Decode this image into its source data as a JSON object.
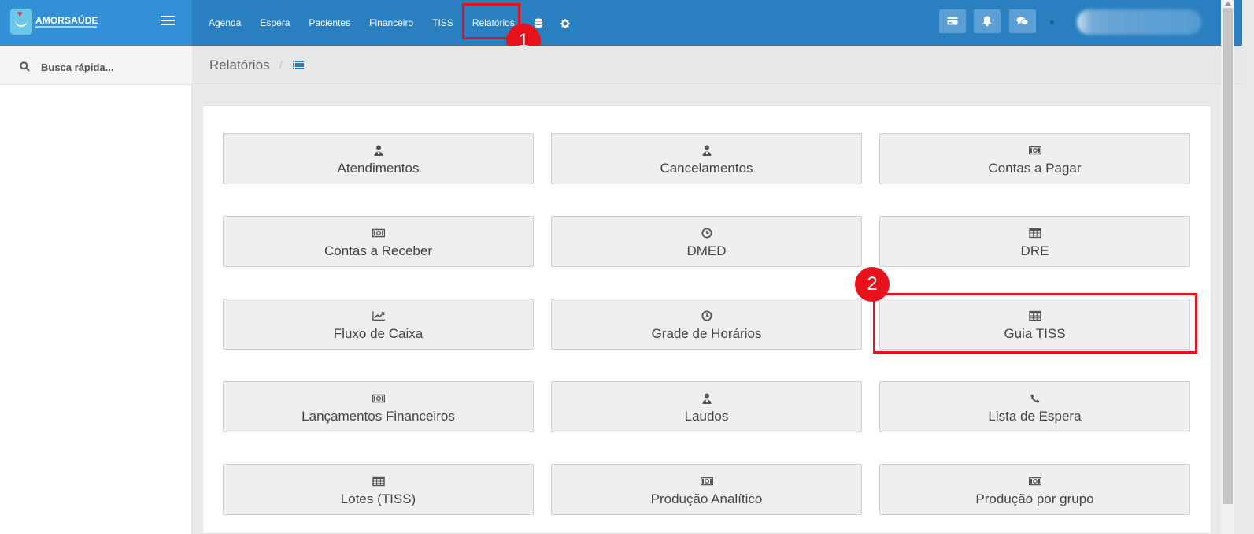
{
  "brand": {
    "logo_text": "AMORSAÚDE"
  },
  "nav": {
    "items": [
      "Agenda",
      "Espera",
      "Pacientes",
      "Financeiro",
      "TISS",
      "Relatórios"
    ]
  },
  "sidebar": {
    "search_placeholder": "Busca rápida..."
  },
  "breadcrumb": {
    "title": "Relatórios",
    "separator": "/"
  },
  "annotations": {
    "step1": "1",
    "step2": "2"
  },
  "reports": [
    {
      "label": "Atendimentos",
      "icon": "user-doctor-icon"
    },
    {
      "label": "Cancelamentos",
      "icon": "user-doctor-icon"
    },
    {
      "label": "Contas a Pagar",
      "icon": "money-bill-icon"
    },
    {
      "label": "Contas a Receber",
      "icon": "money-bill-icon"
    },
    {
      "label": "DMED",
      "icon": "clock-icon"
    },
    {
      "label": "DRE",
      "icon": "table-icon"
    },
    {
      "label": "Fluxo de Caixa",
      "icon": "line-chart-icon"
    },
    {
      "label": "Grade de Horários",
      "icon": "clock-icon"
    },
    {
      "label": "Guia TISS",
      "icon": "table-icon"
    },
    {
      "label": "Lançamentos Financeiros",
      "icon": "money-bill-icon"
    },
    {
      "label": "Laudos",
      "icon": "user-doctor-icon"
    },
    {
      "label": "Lista de Espera",
      "icon": "phone-icon"
    },
    {
      "label": "Lotes (TISS)",
      "icon": "table-icon"
    },
    {
      "label": "Produção Analítico",
      "icon": "money-bill-icon"
    },
    {
      "label": "Produção por grupo",
      "icon": "money-bill-icon"
    }
  ],
  "colors": {
    "topbar": "#2a7fc1",
    "highlight": "#e8121c"
  }
}
